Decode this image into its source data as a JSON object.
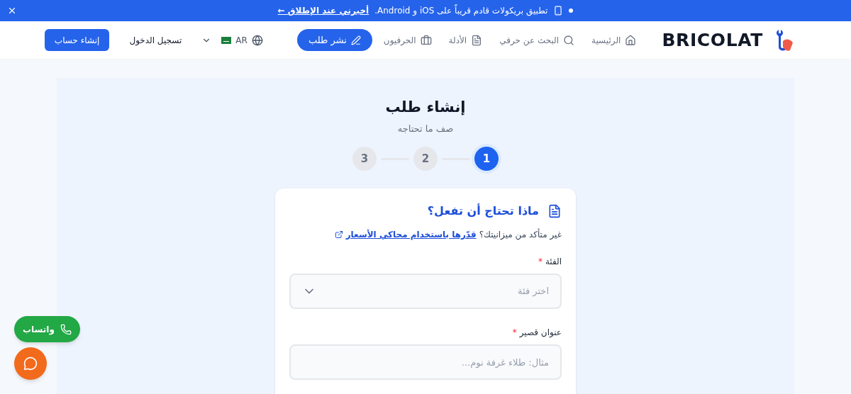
{
  "banner": {
    "text": "تطبيق بريكولات قادم قريباً على iOS و Android.",
    "link": "أخبرني عند الإطلاق ←"
  },
  "header": {
    "brand": "BRICOLAT",
    "nav": [
      {
        "label": "الرئيسية",
        "kind": "home"
      },
      {
        "label": "البحث عن حرفي",
        "kind": "search"
      },
      {
        "label": "الأدلة",
        "kind": "guide"
      },
      {
        "label": "الحرفيون",
        "kind": "craftsmen"
      }
    ],
    "post_button": "نشر طلب",
    "language": "AR",
    "login": "تسجيل الدخول",
    "signup": "إنشاء حساب"
  },
  "page": {
    "title": "إنشاء طلب",
    "subtitle": "صف ما تحتاجه",
    "steps": [
      {
        "label": "1",
        "selected": true
      },
      {
        "label": "2",
        "selected": false
      },
      {
        "label": "3",
        "selected": false
      }
    ]
  },
  "form": {
    "heading": "ماذا تحتاج أن تفعل؟",
    "budget_prompt": "غير متأكد من ميزانيتك؟",
    "budget_link": "قدّرها باستخدام محاكي الأسعار",
    "fields": [
      {
        "kind": "select",
        "label": "الفئة",
        "required_mark": "*",
        "placeholder": "اختر فئة"
      },
      {
        "kind": "text",
        "label": "عنوان قصير",
        "required_mark": "*",
        "placeholder": "مثال: طلاء غرفة نوم..."
      }
    ]
  },
  "floating": {
    "whatsapp": "واتساب"
  }
}
